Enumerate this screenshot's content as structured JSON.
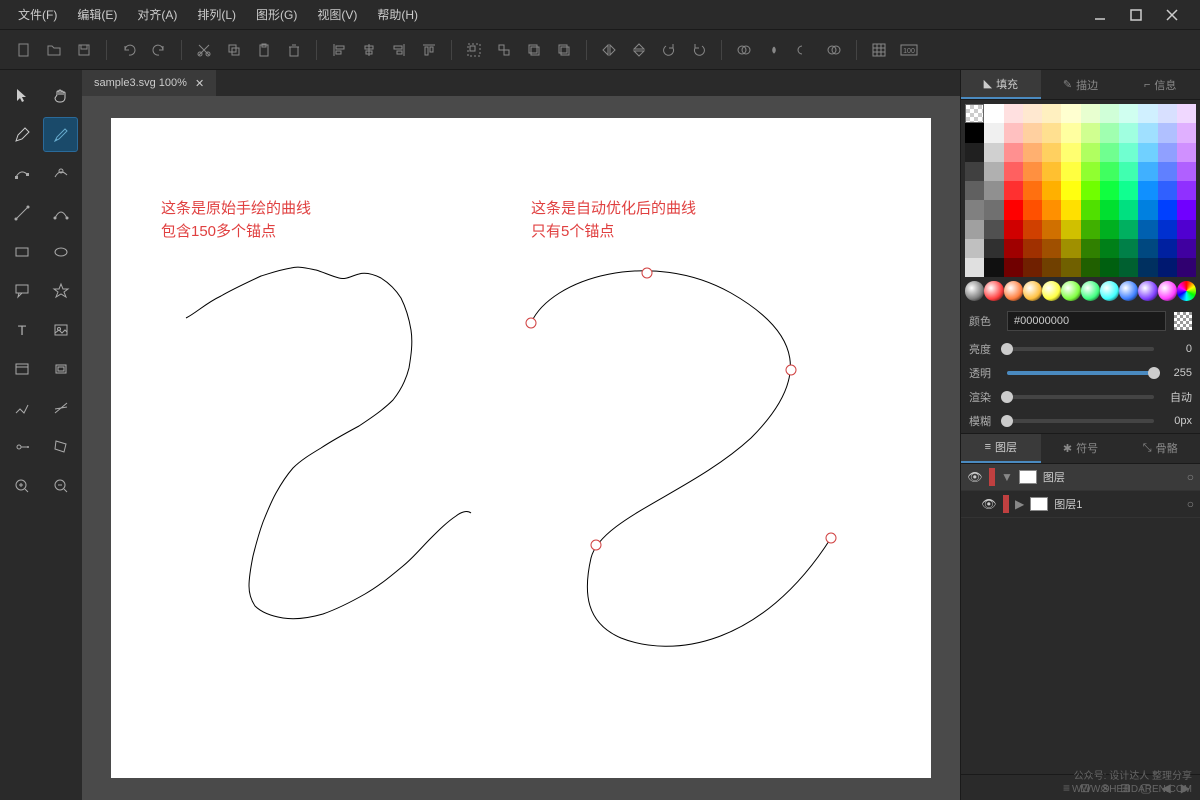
{
  "menu": {
    "file": "文件(F)",
    "edit": "编辑(E)",
    "align": "对齐(A)",
    "arrange": "排列(L)",
    "shape": "图形(G)",
    "view": "视图(V)",
    "help": "帮助(H)"
  },
  "tab": {
    "name": "sample3.svg 100%"
  },
  "canvas_annotations": {
    "left_line1": "这条是原始手绘的曲线",
    "left_line2": "包含150多个锚点",
    "right_line1": "这条是自动优化后的曲线",
    "right_line2": "只有5个锚点"
  },
  "right_tabs": {
    "fill": "填充",
    "stroke": "描边",
    "info": "信息"
  },
  "color": {
    "label": "颜色",
    "value": "#00000000"
  },
  "sliders": {
    "brightness": {
      "label": "亮度",
      "value": "0",
      "percent": 0
    },
    "opacity": {
      "label": "透明",
      "value": "255",
      "percent": 100
    },
    "render": {
      "label": "渲染",
      "value": "自动",
      "percent": 0
    },
    "blur": {
      "label": "模糊",
      "value": "0px",
      "percent": 0
    }
  },
  "layer_tabs": {
    "layers": "图层",
    "symbols": "符号",
    "bones": "骨骼"
  },
  "layers": {
    "root": "图层",
    "child1": "图层1"
  },
  "swatches": [
    [
      "none",
      "#ffffff",
      "#ffe0e0",
      "#ffe8d0",
      "#fff0c0",
      "#ffffd0",
      "#e8ffd0",
      "#d0ffd8",
      "#d0fff0",
      "#d0f0ff",
      "#d8e0ff",
      "#f0d8ff"
    ],
    [
      "#000000",
      "#f0f0f0",
      "#ffc0c0",
      "#ffd0a0",
      "#ffe090",
      "#ffffa0",
      "#d0ff90",
      "#a0ffb0",
      "#a0ffe0",
      "#a0e0ff",
      "#b0c0ff",
      "#e0b0ff"
    ],
    [
      "#202020",
      "#d0d0d0",
      "#ff9090",
      "#ffb070",
      "#ffd060",
      "#ffff70",
      "#b0ff60",
      "#70ff90",
      "#70ffd0",
      "#70d0ff",
      "#90a0ff",
      "#d090ff"
    ],
    [
      "#404040",
      "#b0b0b0",
      "#ff6060",
      "#ff9040",
      "#ffc030",
      "#ffff40",
      "#90ff30",
      "#40ff60",
      "#40ffb0",
      "#40b0ff",
      "#6080ff",
      "#b060ff"
    ],
    [
      "#606060",
      "#909090",
      "#ff3030",
      "#ff7010",
      "#ffb000",
      "#ffff10",
      "#70ff00",
      "#10ff40",
      "#10ff90",
      "#1090ff",
      "#3060ff",
      "#9030ff"
    ],
    [
      "#808080",
      "#707070",
      "#ff0000",
      "#ff5000",
      "#ff9000",
      "#ffe000",
      "#50e000",
      "#00e030",
      "#00e080",
      "#0080e0",
      "#0040ff",
      "#7000ff"
    ],
    [
      "#a0a0a0",
      "#505050",
      "#d00000",
      "#d04000",
      "#d07000",
      "#d0c000",
      "#40b000",
      "#00b020",
      "#00b060",
      "#0060b0",
      "#0030d0",
      "#5000d0"
    ],
    [
      "#c0c0c0",
      "#303030",
      "#a00000",
      "#a03000",
      "#a05000",
      "#a09000",
      "#308000",
      "#008018",
      "#008048",
      "#004880",
      "#0020a0",
      "#4000a0"
    ],
    [
      "#e0e0e0",
      "#101010",
      "#700000",
      "#702000",
      "#704000",
      "#706000",
      "#206000",
      "#006010",
      "#006030",
      "#003060",
      "#001870",
      "#300070"
    ]
  ],
  "gradients": [
    "#808080",
    "#ff4040",
    "#ff8040",
    "#ffc040",
    "#ffff40",
    "#80ff40",
    "#40ff80",
    "#40ffff",
    "#4080ff",
    "#8040ff",
    "#ff40ff",
    "#ff0080"
  ],
  "watermark": {
    "line1": "公众号: 设计达人 整理分享",
    "line2": "WWW.SHEJIDAREN.COM"
  }
}
